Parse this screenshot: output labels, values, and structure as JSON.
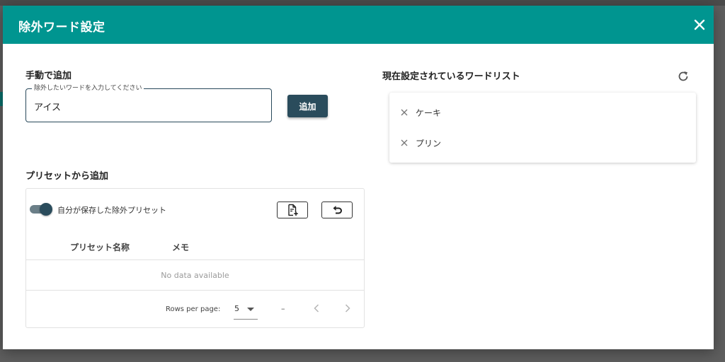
{
  "dialog": {
    "title": "除外ワード設定"
  },
  "manual": {
    "section_title": "手動で追加",
    "input_label": "除外したいワードを入力してください",
    "input_value": "アイス",
    "add_button": "追加"
  },
  "preset": {
    "section_title": "プリセットから追加",
    "toggle_label": "自分が保存した除外プリセット",
    "toggle_on": true,
    "columns": [
      "プリセット名称",
      "メモ"
    ],
    "empty_text": "No data available",
    "rows_per_page_label": "Rows per page:",
    "rows_per_page_value": "5",
    "page_info": "–"
  },
  "wordlist": {
    "section_title": "現在設定されているワードリスト",
    "items": [
      {
        "label": "ケーキ"
      },
      {
        "label": "プリン"
      }
    ]
  },
  "colors": {
    "header": "#009590",
    "primary_button": "#2a4c5c",
    "backdrop": "#5e5e5e"
  },
  "icons": [
    "close-icon",
    "add-file-icon",
    "undo-icon",
    "refresh-icon",
    "remove-icon",
    "chevron-left-icon",
    "chevron-right-icon",
    "dropdown-caret-icon"
  ]
}
